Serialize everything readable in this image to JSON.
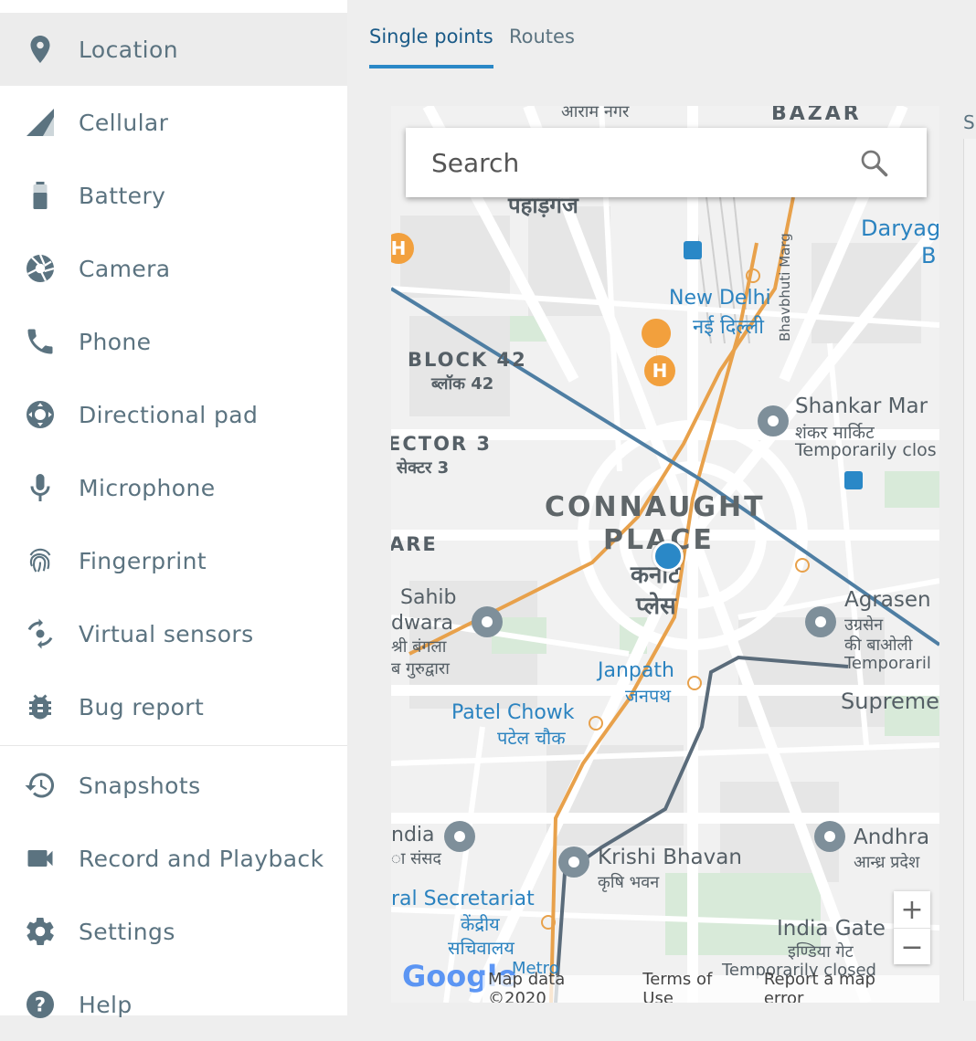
{
  "sidebar": {
    "items": [
      {
        "label": "Location",
        "icon": "location-pin-icon"
      },
      {
        "label": "Cellular",
        "icon": "cellular-signal-icon"
      },
      {
        "label": "Battery",
        "icon": "battery-icon"
      },
      {
        "label": "Camera",
        "icon": "camera-aperture-icon"
      },
      {
        "label": "Phone",
        "icon": "phone-icon"
      },
      {
        "label": "Directional pad",
        "icon": "dpad-icon"
      },
      {
        "label": "Microphone",
        "icon": "microphone-icon"
      },
      {
        "label": "Fingerprint",
        "icon": "fingerprint-icon"
      },
      {
        "label": "Virtual sensors",
        "icon": "rotation-sensor-icon"
      },
      {
        "label": "Bug report",
        "icon": "bug-icon"
      },
      {
        "label": "Snapshots",
        "icon": "history-icon"
      },
      {
        "label": "Record and Playback",
        "icon": "videocam-icon"
      },
      {
        "label": "Settings",
        "icon": "gear-icon"
      },
      {
        "label": "Help",
        "icon": "help-icon"
      }
    ],
    "active": "Location",
    "accent_color": "#5b7380"
  },
  "tabs": {
    "single": "Single points",
    "routes": "Routes",
    "active": "Single points",
    "accent_color": "#2a88c7"
  },
  "right_panel": {
    "cut_label": "Sa"
  },
  "map": {
    "search_placeholder": "Search",
    "zoom_in": "+",
    "zoom_out": "−",
    "attribution": {
      "map_data": "Map data ©2020",
      "terms": "Terms of Use",
      "report": "Report a map error",
      "logo": "Google"
    },
    "labels": {
      "bazar": "BAZAR",
      "top_hindi": "आराम नगर",
      "paharganj": "पहाड़गंज",
      "daryaganj": "Daryag",
      "daryaganj2": "B",
      "new_delhi": "New Delhi",
      "new_delhi_hi": "नई दिल्ली",
      "bhavbhuti": "Bhavbhuti Marg",
      "block42": "BLOCK 42",
      "block42_hi": "ब्लॉक 42",
      "shankar": "Shankar Mar",
      "shankar_hi": "शंकर मार्किट",
      "shankar_status": "Temporarily clos",
      "sector3": "ECTOR 3",
      "sector3_hi": "सेक्टर 3",
      "connaught": "CONNAUGHT",
      "place": "PLACE",
      "connaught_hi": "कनॉट",
      "place_hi": "प्लेस",
      "are": "ARE",
      "sahib": "Sahib",
      "dwara": "dwara",
      "bangla_hi": "श्री बंगला",
      "gurudwara_hi": "ब गुरुद्वारा",
      "agrasen": "Agrasen",
      "agrasen_hi": "उग्रसेन",
      "baoli_hi": "की बाओली",
      "agrasen_status": "Temporaril",
      "janpath": "Janpath",
      "janpath_hi": "जनपथ",
      "patel": "Patel Chowk",
      "patel_hi": "पटेल चौक",
      "supreme": "Supreme",
      "india": "ndia",
      "sansad_hi": "ा संसद",
      "krishi": "Krishi Bhavan",
      "krishi_hi": "कृषि भवन",
      "andhra": "Andhra",
      "andhra_hi": "आन्ध्र प्रदेश",
      "secretariat": "ral Secretariat",
      "kendriya_hi": "केंद्रीय",
      "sachivalaya_hi": "सचिवालय",
      "metro": "Metro",
      "indiagate": "India Gate",
      "indiagate_hi": "इण्डिया गेट",
      "indiagate_status": "Temporarily closed"
    }
  }
}
